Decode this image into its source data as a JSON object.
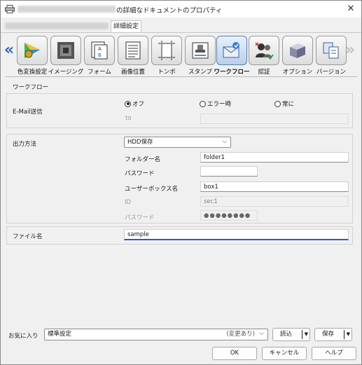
{
  "window": {
    "title": "の詳細なドキュメントのプロパティ",
    "close_glyph": "✕"
  },
  "tabs": {
    "active_label": "詳細設定"
  },
  "nav": {
    "prev_glyph": "«",
    "next_glyph": "»"
  },
  "toolbar": {
    "items": [
      {
        "label": "色変換設定",
        "icon": "color-conversion-icon"
      },
      {
        "label": "イメージング",
        "icon": "imaging-icon"
      },
      {
        "label": "フォーム",
        "icon": "form-icon"
      },
      {
        "label": "画像位置",
        "icon": "image-position-icon"
      },
      {
        "label": "トンボ",
        "icon": "crop-marks-icon"
      },
      {
        "label": "スタンプ",
        "icon": "stamp-icon"
      },
      {
        "label": "ワークフロー",
        "icon": "workflow-icon",
        "selected": true
      },
      {
        "label": "認証",
        "icon": "authentication-icon"
      },
      {
        "label": "オプション",
        "icon": "options-icon"
      },
      {
        "label": "バージョン",
        "icon": "version-icon"
      }
    ]
  },
  "workflow": {
    "section_title": "ワークフロー",
    "email": {
      "label": "E-Mail送信",
      "options": [
        "オフ",
        "エラー時",
        "常に"
      ],
      "selected": "オフ",
      "to_label": "to",
      "to_value": ""
    },
    "output": {
      "label": "出力方法",
      "method_value": "HDD保存",
      "folder_label": "フォルダー名",
      "folder_value": "folder1",
      "password_label": "パスワード",
      "password_value": "",
      "userbox_label": "ユーザーボックス名",
      "userbox_value": "box1",
      "id_label": "ID",
      "id_value": "sec1",
      "password2_label": "パスワード",
      "password2_value": "●●●●●●●●"
    },
    "file": {
      "label": "ファイル名",
      "value": "sample"
    }
  },
  "favorites": {
    "label": "お気に入り",
    "value": "標準設定",
    "changed_note": "(変更あり)",
    "load_label": "読込",
    "save_label": "保存"
  },
  "buttons": {
    "ok": "OK",
    "cancel": "キャンセル",
    "help": "ヘルプ"
  },
  "colors": {
    "accent": "#1f5fb8",
    "arrow_active": "#2e66b3"
  }
}
